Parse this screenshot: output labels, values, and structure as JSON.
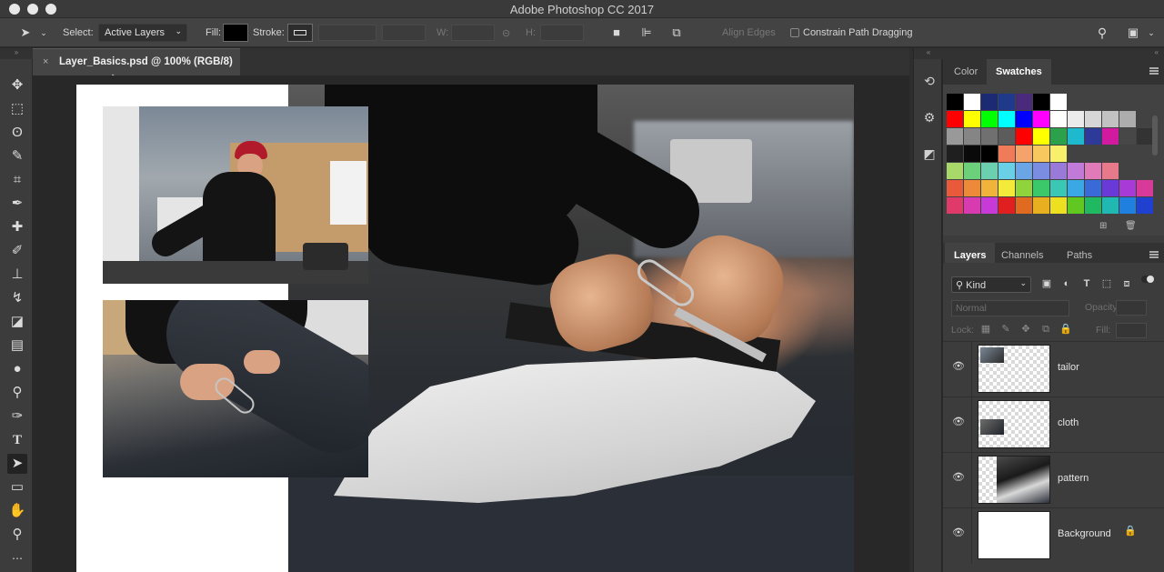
{
  "app": {
    "window_title": "Adobe Photoshop CC 2017"
  },
  "options_bar": {
    "select_label": "Select:",
    "select_value": "Active Layers",
    "fill_label": "Fill:",
    "stroke_label": "Stroke:",
    "w_label": "W:",
    "h_label": "H:",
    "align_edges_label": "Align Edges",
    "constrain_label": "Constrain Path Dragging"
  },
  "document_tab": {
    "close": "×",
    "name": "Layer_Basics.psd @ 100% (RGB/8)"
  },
  "color_panel": {
    "tabs": [
      "Color",
      "Swatches"
    ],
    "active_tab": "Swatches",
    "swatch_rows": [
      [
        "#000000",
        "#ffffff",
        "#1c2a73",
        "#1f3a8a",
        "#4a2a7a",
        "#000000",
        "#ffffff"
      ],
      [
        "#ff0000",
        "#ffff00",
        "#00ff00",
        "#00ffff",
        "#0000ff",
        "#ff00ff",
        "#ffffff",
        "#ebebeb",
        "#d6d6d6",
        "#c2c2c2",
        "#adadad"
      ],
      [
        "#999999",
        "#858585",
        "#707070",
        "#5c5c5c",
        "#ff0000",
        "#ffff00",
        "#2aa14a",
        "#1fb9ce",
        "#2d3a9a",
        "#d11aa0",
        "#474747",
        "#333333"
      ],
      [
        "#1f1f1f",
        "#0a0a0a",
        "#000000",
        "#f07b5a",
        "#f4a46a",
        "#f6c85e",
        "#f8f06a"
      ],
      [
        "#a8d86a",
        "#6ccf7a",
        "#6bd0b0",
        "#6ad0e6",
        "#6aa6e6",
        "#7a8de0",
        "#9a7ad8",
        "#c27ad8",
        "#e07ab8",
        "#e67a8a"
      ],
      [
        "#e85a3a",
        "#ec8a3a",
        "#f0b43a",
        "#f4ea3a",
        "#8ed43a",
        "#3ac86a",
        "#3ac8b4",
        "#3aa8e4",
        "#3a6ad8",
        "#6a3ad8",
        "#a83ad8",
        "#d83a9a"
      ],
      [
        "#e03a6a",
        "#d83ab0",
        "#c83ad8",
        "#e02020",
        "#e06a20",
        "#e8b020",
        "#ece020",
        "#60c820",
        "#20b860",
        "#20b8b0",
        "#2080e0",
        "#2040d0"
      ]
    ]
  },
  "layers_panel": {
    "tabs": [
      "Layers",
      "Channels",
      "Paths"
    ],
    "active_tab": "Layers",
    "kind_filter": "Kind",
    "blend_mode": "Normal",
    "opacity_label": "Opacity:",
    "lock_label": "Lock:",
    "fill_label": "Fill:",
    "layers": [
      {
        "name": "tailor",
        "locked": false
      },
      {
        "name": "cloth",
        "locked": false
      },
      {
        "name": "pattern",
        "locked": false
      },
      {
        "name": "Background",
        "locked": true
      }
    ]
  },
  "tools": [
    "move-tool",
    "marquee-tool",
    "lasso-tool",
    "quick-select-tool",
    "crop-tool",
    "eyedropper-tool",
    "healing-brush-tool",
    "brush-tool",
    "clone-stamp-tool",
    "history-brush-tool",
    "eraser-tool",
    "gradient-tool",
    "blur-tool",
    "dodge-tool",
    "pen-tool",
    "type-tool",
    "path-selection-tool",
    "rectangle-tool",
    "hand-tool",
    "zoom-tool",
    "more-tools"
  ],
  "active_tool": "path-selection-tool"
}
